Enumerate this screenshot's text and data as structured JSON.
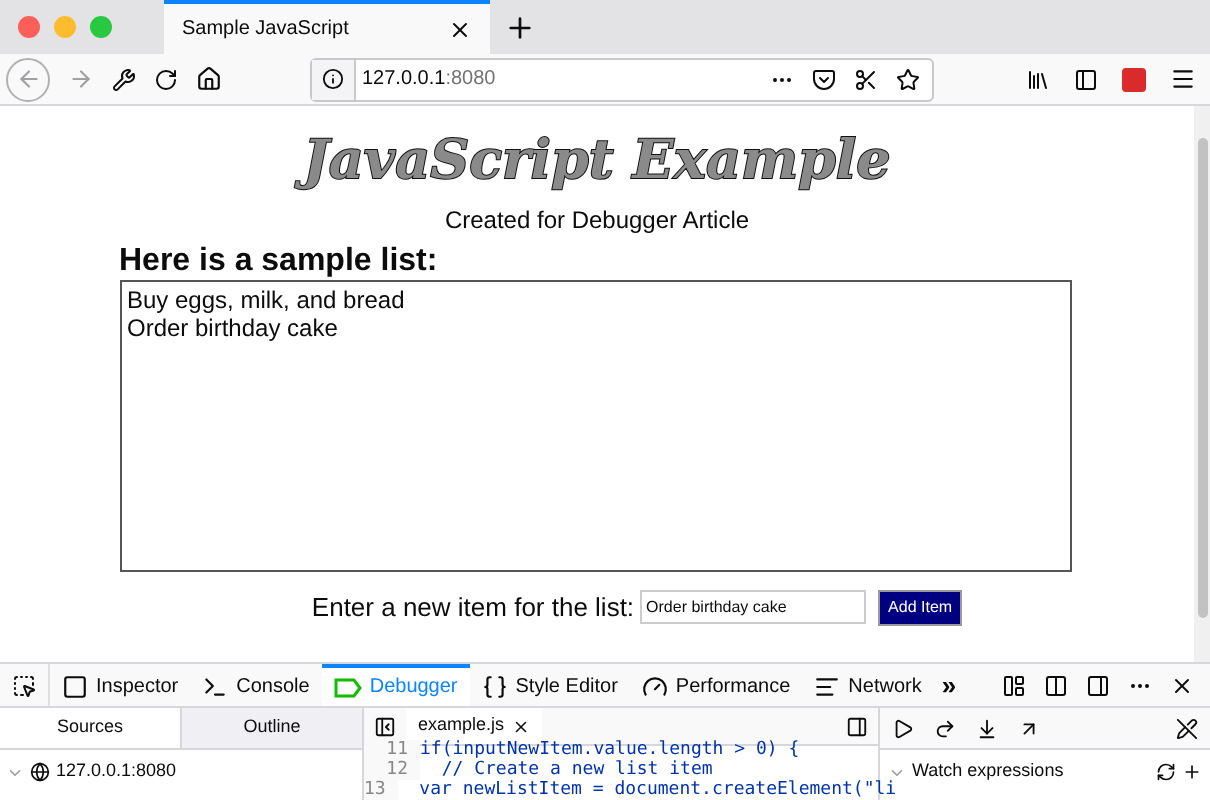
{
  "browser": {
    "tabs": [
      {
        "title": "Sample JavaScript",
        "selected": true
      }
    ],
    "url_host": "127.0.0.1",
    "url_port": ":8080"
  },
  "page": {
    "title": "JavaScript Example",
    "subtitle": "Created for Debugger Article",
    "list_heading": "Here is a sample list:",
    "items": [
      "Buy eggs, milk, and bread",
      "Order birthday cake"
    ],
    "input_label": "Enter a new item for the list:",
    "input_value": "Order birthday cake",
    "add_button": "Add Item"
  },
  "devtools": {
    "tools": [
      {
        "label": "Inspector",
        "selected": false,
        "kind": "inspector"
      },
      {
        "label": "Console",
        "selected": false,
        "kind": "console"
      },
      {
        "label": "Debugger",
        "selected": true,
        "kind": "debugger"
      },
      {
        "label": "Style Editor",
        "selected": false,
        "kind": "style"
      },
      {
        "label": "Performance",
        "selected": false,
        "kind": "performance"
      },
      {
        "label": "Network",
        "selected": false,
        "kind": "network"
      }
    ],
    "overflow": "»",
    "source_tabs": [
      {
        "label": "Sources",
        "selected": true
      },
      {
        "label": "Outline",
        "selected": false
      }
    ],
    "tree": [
      {
        "label": "127.0.0.1:8080",
        "expanded": true
      }
    ],
    "file_tab": "example.js",
    "code": [
      {
        "line": "11",
        "text": "if(inputNewItem.value.length > 0) {"
      },
      {
        "line": "12",
        "text": "  // Create a new list item"
      },
      {
        "line": "13",
        "text": "  var newListItem = document.createElement(\"li"
      }
    ],
    "watch_title": "Watch expressions"
  }
}
